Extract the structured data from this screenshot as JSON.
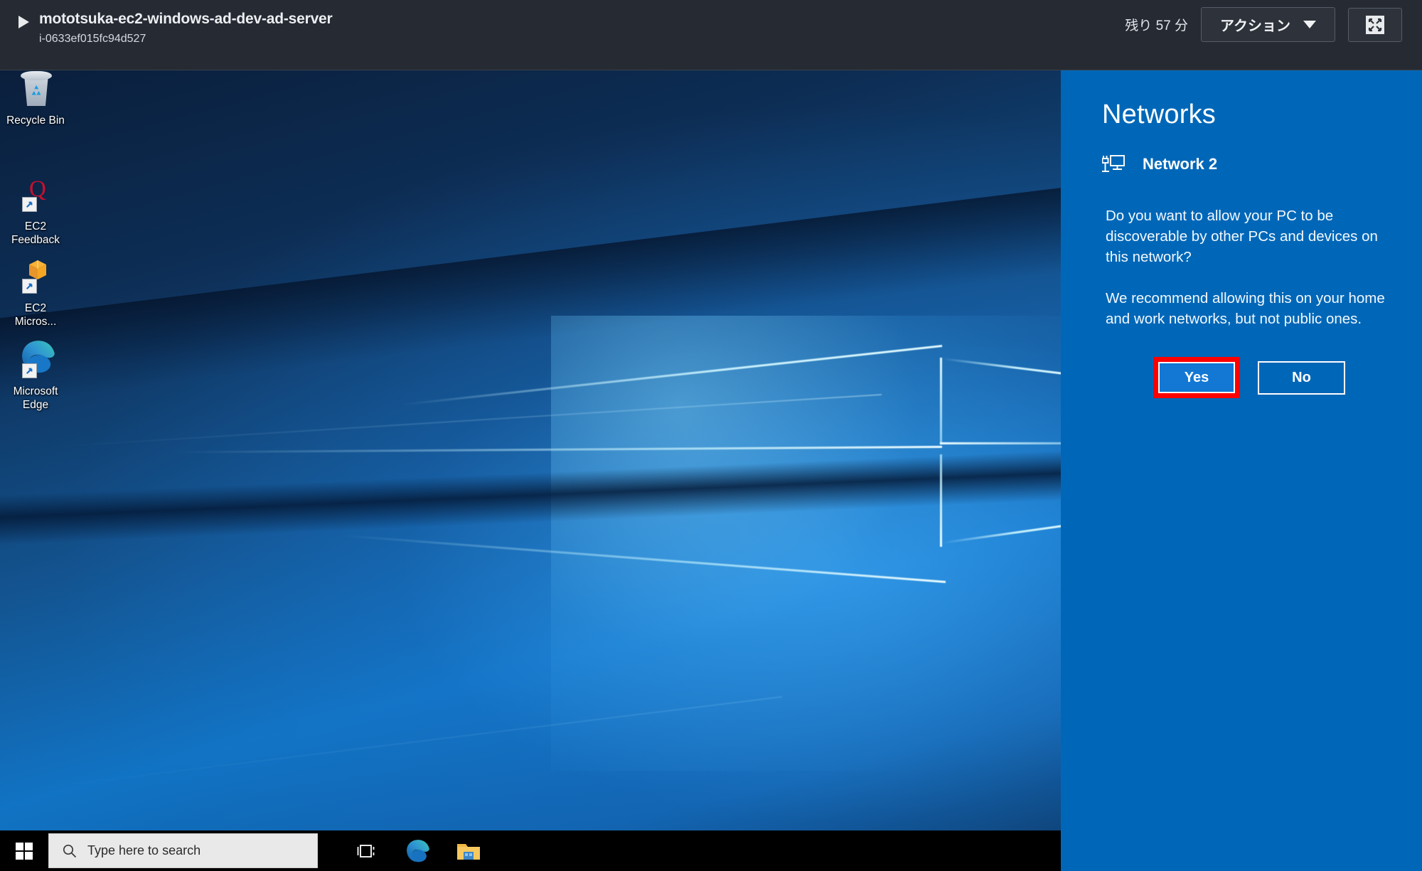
{
  "header": {
    "play_icon": "play-triangle-icon",
    "instance_name": "mototsuka-ec2-windows-ad-dev-ad-server",
    "instance_id": "i-0633ef015fc94d527",
    "time_remaining": "残り 57 分",
    "action_button_label": "アクション",
    "caret_icon": "chevron-down-icon",
    "fullscreen_icon": "fullscreen-expand-icon"
  },
  "desktop": {
    "icons": [
      {
        "label": "Recycle Bin",
        "icon": "recycle-bin-icon",
        "shortcut": false
      },
      {
        "label": "EC2\nFeedback",
        "label_line1": "EC2",
        "label_line2": "Feedback",
        "icon": "ec2-feedback-icon",
        "shortcut": true
      },
      {
        "label": "EC2\nMicros...",
        "label_line1": "EC2",
        "label_line2": "Micros...",
        "icon": "ec2-microsoft-box-icon",
        "shortcut": true
      },
      {
        "label": "Microsoft\nEdge",
        "label_line1": "Microsoft",
        "label_line2": "Edge",
        "icon": "microsoft-edge-icon",
        "shortcut": true
      }
    ]
  },
  "taskbar": {
    "start_icon": "windows-start-icon",
    "search_icon": "search-icon",
    "search_placeholder": "Type here to search",
    "task_view_icon": "task-view-icon",
    "edge_icon": "microsoft-edge-icon",
    "file_explorer_icon": "file-explorer-icon"
  },
  "networks_flyout": {
    "title": "Networks",
    "network_icon": "ethernet-network-icon",
    "network_name": "Network 2",
    "question": "Do you want to allow your PC to be discoverable by other PCs and devices on this network?",
    "recommendation": "We recommend allowing this on your home and work networks, but not public ones.",
    "yes_label": "Yes",
    "no_label": "No"
  },
  "colors": {
    "header_bg": "#252a33",
    "flyout_blue": "#0067b8",
    "yes_button_blue": "#1278d4",
    "highlight_red": "#ff0000",
    "taskbar_black": "#000000",
    "search_box_gray": "#e9e9e9"
  }
}
